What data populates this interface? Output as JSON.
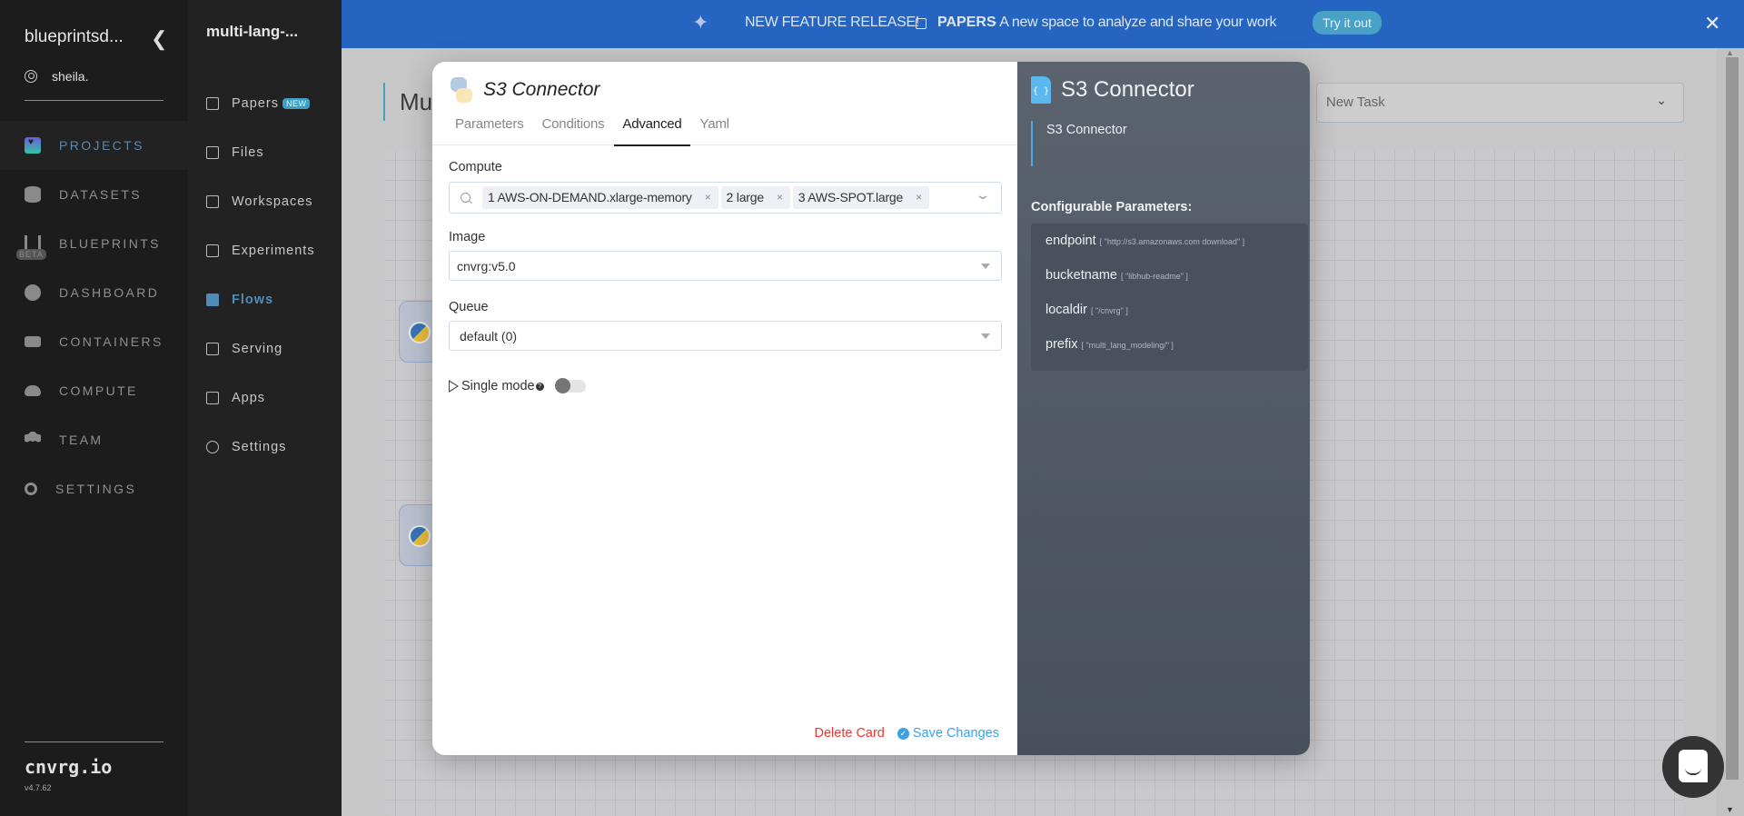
{
  "sidebar": {
    "org_name": "blueprintsd...",
    "user": "sheila.",
    "items": [
      {
        "label": "PROJECTS",
        "icon": "projects-icon",
        "active": true
      },
      {
        "label": "DATASETS",
        "icon": "datasets-icon"
      },
      {
        "label": "BLUEPRINTS",
        "icon": "blueprints-icon",
        "badge": "BETA"
      },
      {
        "label": "DASHBOARD",
        "icon": "dashboard-icon"
      },
      {
        "label": "CONTAINERS",
        "icon": "containers-icon"
      },
      {
        "label": "COMPUTE",
        "icon": "cloud-icon"
      },
      {
        "label": "TEAM",
        "icon": "team-icon"
      },
      {
        "label": "SETTINGS",
        "icon": "gears-icon"
      }
    ],
    "brand": "cnvrg.io",
    "version": "v4.7.62"
  },
  "project_sidebar": {
    "title": "multi-lang-...",
    "items": [
      {
        "label": "Papers",
        "icon": "papers-icon",
        "badge": "NEW"
      },
      {
        "label": "Files",
        "icon": "file-icon"
      },
      {
        "label": "Workspaces",
        "icon": "clipboard-icon"
      },
      {
        "label": "Experiments",
        "icon": "flask-icon"
      },
      {
        "label": "Flows",
        "icon": "flows-icon",
        "active": true
      },
      {
        "label": "Serving",
        "icon": "rocket-icon"
      },
      {
        "label": "Apps",
        "icon": "grid-icon"
      },
      {
        "label": "Settings",
        "icon": "gear-icon"
      }
    ]
  },
  "banner": {
    "headline": "NEW FEATURE RELEASE!",
    "feature": "PAPERS",
    "description": "- A new space to analyze and share your work",
    "cta": "Try it out",
    "close": "✕"
  },
  "workspace": {
    "title": "Mu",
    "task_select": {
      "value": "New Task"
    }
  },
  "modal": {
    "title": "S3 Connector",
    "tabs": [
      {
        "label": "Parameters"
      },
      {
        "label": "Conditions"
      },
      {
        "label": "Advanced",
        "active": true
      },
      {
        "label": "Yaml"
      }
    ],
    "compute": {
      "label": "Compute",
      "chips": [
        "1 AWS-ON-DEMAND.xlarge-memory",
        "2 large",
        "3 AWS-SPOT.large"
      ]
    },
    "image": {
      "label": "Image",
      "value": "cnvrg:v5.0"
    },
    "queue": {
      "label": "Queue",
      "value": "default (0)"
    },
    "single_mode": {
      "label": "Single mode",
      "help": "?",
      "enabled": false
    },
    "delete_label": "Delete Card",
    "save_label": "Save Changes"
  },
  "info_panel": {
    "title": "S3 Connector",
    "description": "S3 Connector",
    "configurable_label": "Configurable Parameters:",
    "params": [
      {
        "name": "endpoint",
        "value": "[ \"http://s3.amazonaws.com download\" ]"
      },
      {
        "name": "bucketname",
        "value": "[ \"libhub-readme\" ]"
      },
      {
        "name": "localdir",
        "value": "[ \"/cnvrg\" ]"
      },
      {
        "name": "prefix",
        "value": "[ \"multi_lang_modeling/\" ]"
      }
    ]
  }
}
